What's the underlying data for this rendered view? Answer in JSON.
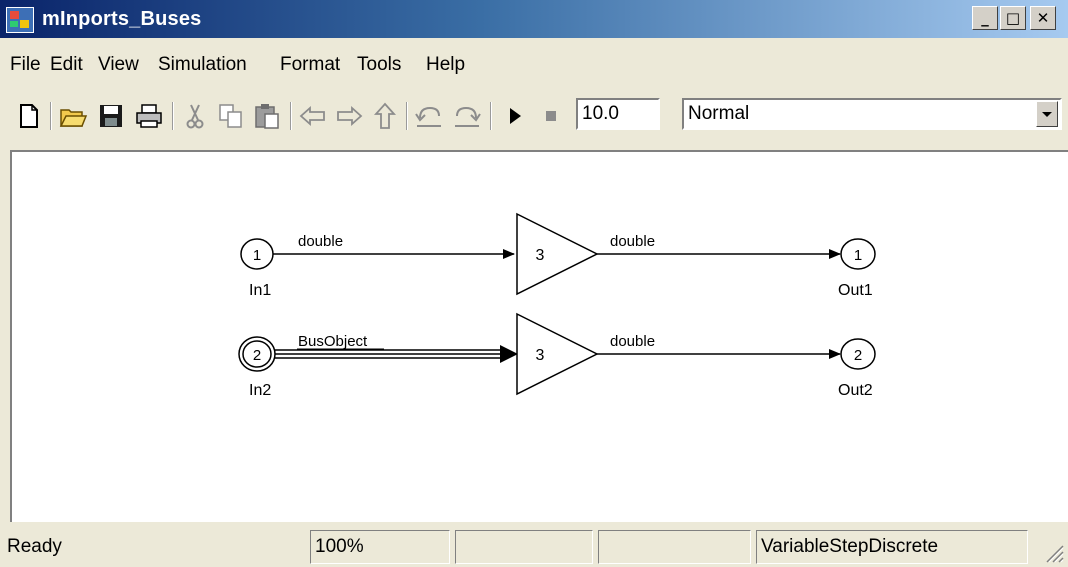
{
  "window": {
    "title": "mInports_Buses"
  },
  "menu": {
    "items": [
      "File",
      "Edit",
      "View",
      "Simulation",
      "Format",
      "Tools",
      "Help"
    ]
  },
  "toolbar": {
    "stop_time": "10.0",
    "sim_mode": "Normal",
    "icons": [
      "new-file-icon",
      "open-folder-icon",
      "save-icon",
      "print-icon",
      "cut-icon",
      "copy-icon",
      "paste-icon",
      "back-icon",
      "forward-icon",
      "up-icon",
      "undo-icon",
      "redo-icon",
      "start-simulation-icon",
      "stop-simulation-icon"
    ]
  },
  "diagram": {
    "in1": {
      "number": "1",
      "label": "In1"
    },
    "in2": {
      "number": "2",
      "label": "In2"
    },
    "gain1": {
      "value": "3"
    },
    "gain2": {
      "value": "3"
    },
    "out1": {
      "number": "1",
      "label": "Out1"
    },
    "out2": {
      "number": "2",
      "label": "Out2"
    },
    "signals": {
      "in1_to_gain1": "double",
      "gain1_to_out1": "double",
      "in2_to_gain2": "BusObject",
      "gain2_to_out2": "double"
    }
  },
  "status": {
    "state": "Ready",
    "zoom": "100%",
    "cell3": "",
    "cell4": "",
    "solver": "VariableStepDiscrete"
  },
  "colors": {
    "title_start": "#0A246A",
    "title_end": "#A6CAF0",
    "chrome": "#ECE9D8"
  }
}
